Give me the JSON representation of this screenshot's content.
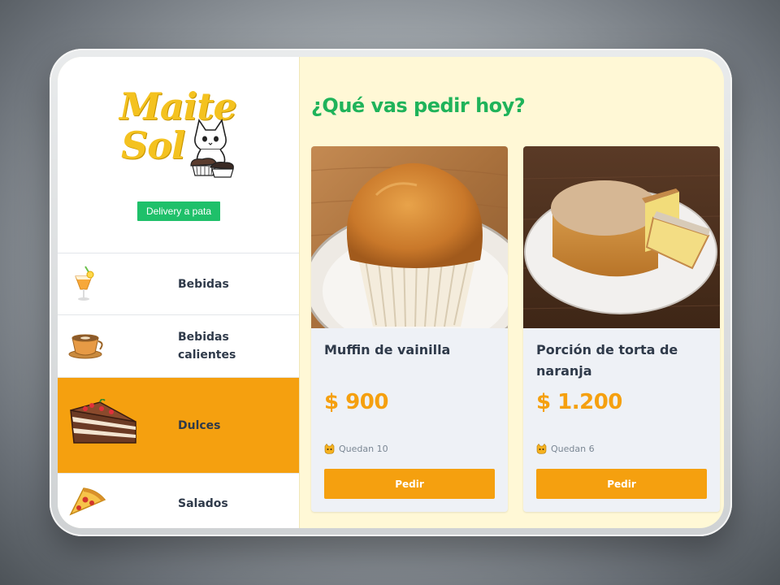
{
  "brand": {
    "logo_line1": "Maite",
    "logo_line2": "Sol",
    "tagline": "Delivery a pata"
  },
  "categories": [
    {
      "label": "Bebidas",
      "icon": "juice-glass-icon",
      "active": false
    },
    {
      "label": "Bebidas calientes",
      "icon": "coffee-cup-icon",
      "active": false
    },
    {
      "label": "Dulces",
      "icon": "cake-slice-icon",
      "active": true
    },
    {
      "label": "Salados",
      "icon": "pizza-slice-icon",
      "active": false
    }
  ],
  "main": {
    "heading": "¿Qué vas pedir hoy?"
  },
  "products": [
    {
      "name": "Muffin de vainilla",
      "price": "$ 900",
      "stock": "Quedan 10",
      "button": "Pedir",
      "image": "muffin-photo"
    },
    {
      "name": "Porción de torta de naranja",
      "price": "$ 1.200",
      "stock": "Quedan 6",
      "button": "Pedir",
      "image": "orange-cake-photo"
    }
  ],
  "colors": {
    "accent": "#f5a00f",
    "heading": "#1fb35a",
    "tagline_bg": "#1fc06a",
    "main_bg": "#fff8d6",
    "text": "#2f3a4a"
  }
}
